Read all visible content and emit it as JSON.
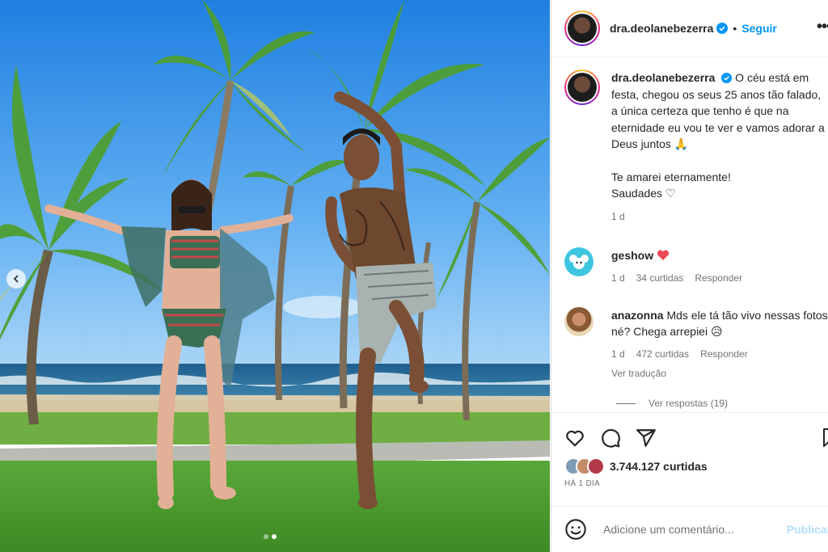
{
  "post": {
    "author": "dra.deolanebezerra",
    "follow_label": "Seguir",
    "separator": "•",
    "more_label": "•••",
    "caption_line1": "O céu está em festa, chegou os seus 25 anos tão falado, a única certeza que tenho é que na eternidade eu vou te ver e vamos adorar a Deus juntos 🙏",
    "caption_line2": "Te amarei eternamente!",
    "caption_line3": "Saudades ♡",
    "caption_time": "1 d",
    "photo_dots": 2,
    "photo_active_dot": 2
  },
  "comments": [
    {
      "user": "geshow",
      "text": "",
      "time": "1 d",
      "likes": "34 curtidas",
      "reply_label": "Responder",
      "avatar_color": "#3ec6e0"
    },
    {
      "user": "anazonna",
      "text": "Mds ele tá tão vivo nessas fotos né? Chega arrepiei 😥",
      "time": "1 d",
      "likes": "472 curtidas",
      "reply_label": "Responder",
      "translate_label": "Ver tradução",
      "avatar_color": "#d8b27a"
    }
  ],
  "view_replies": "Ver respostas (19)",
  "actions": {
    "like_icon": "heart-outline-icon",
    "comment_icon": "comment-bubble-icon",
    "share_icon": "paper-plane-icon",
    "save_icon": "bookmark-icon",
    "likes_count": "3.744.127 curtidas",
    "date": "HÁ 1 DIA"
  },
  "add_comment": {
    "placeholder": "Adicione um comentário...",
    "publish_label": "Publicar"
  },
  "colors": {
    "accent": "#0095f6",
    "verified": "#0095f6",
    "heart_red": "#ed4956",
    "muted": "#737373"
  }
}
